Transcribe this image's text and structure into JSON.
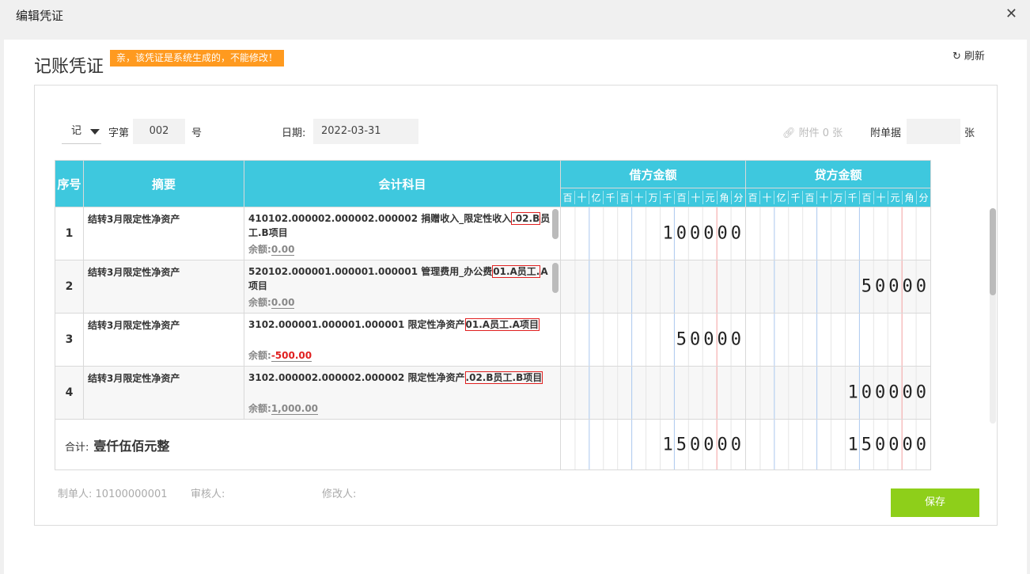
{
  "window": {
    "title": "编辑凭证"
  },
  "voucher": {
    "title": "记账凭证",
    "warning": "亲，该凭证是系统生成的，不能修改！",
    "refresh_label": "刷新",
    "type_value": "记",
    "word_label": "字第",
    "number_value": "002",
    "number_suffix": "号",
    "date_label": "日期:",
    "date_value": "2022-03-31",
    "attachment_label": "附件 0 张",
    "doc_label": "附单据",
    "doc_value": "",
    "doc_suffix": "张"
  },
  "table": {
    "headers": {
      "no": "序号",
      "summary": "摘要",
      "account": "会计科目",
      "debit": "借方金额",
      "credit": "贷方金额"
    },
    "digit_units": [
      "百",
      "十",
      "亿",
      "千",
      "百",
      "十",
      "万",
      "千",
      "百",
      "十",
      "元",
      "角",
      "分"
    ],
    "balance_label": "余额:",
    "rows": [
      {
        "no": "1",
        "summary": "结转3月限定性净资产",
        "account_pre": "410102.000002.000002.000002 捐赠收入_限定性收入",
        "account_hl": ".02.B",
        "account_post": "员工.B项目",
        "balance": "0.00",
        "debit": "100000",
        "credit": ""
      },
      {
        "no": "2",
        "summary": "结转3月限定性净资产",
        "account_pre": "520102.000001.000001.000001 管理费用_办公费",
        "account_hl": "01.A员工.",
        "account_post": "A项目",
        "balance": "0.00",
        "debit": "",
        "credit": "50000"
      },
      {
        "no": "3",
        "summary": "结转3月限定性净资产",
        "account_pre": "3102.000001.000001.000001 限定性净资产",
        "account_hl": "01.A员工.A项目",
        "account_post": "",
        "balance": "-500.00",
        "debit": "50000",
        "credit": ""
      },
      {
        "no": "4",
        "summary": "结转3月限定性净资产",
        "account_pre": "3102.000002.000002.000002 限定性净资产",
        "account_hl": ".02.B员工.B项目",
        "account_post": "",
        "balance": "1,000.00",
        "debit": "",
        "credit": "100000"
      }
    ],
    "total": {
      "label": "合计:",
      "words": "壹仟伍佰元整",
      "debit": "150000",
      "credit": "150000"
    }
  },
  "footer": {
    "maker_label": "制单人:",
    "maker_value": "10100000001",
    "reviewer_label": "审核人:",
    "modifier_label": "修改人:",
    "save_label": "保存"
  }
}
